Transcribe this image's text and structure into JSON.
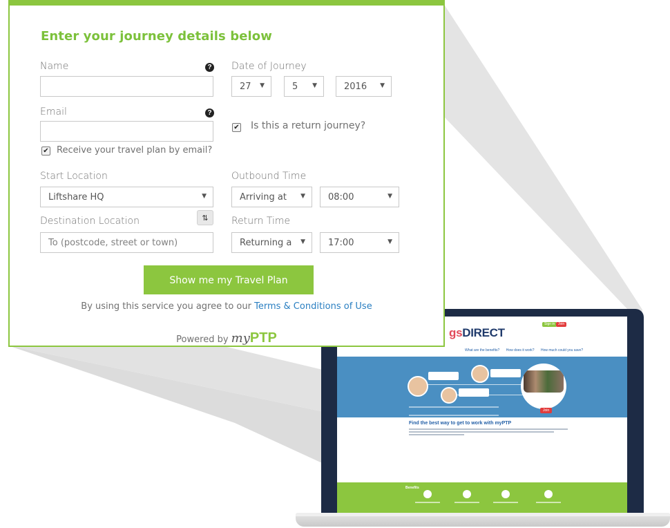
{
  "form": {
    "heading": "Enter your journey details below",
    "name": {
      "label": "Name",
      "value": ""
    },
    "email": {
      "label": "Email",
      "value": ""
    },
    "email_opt_in": {
      "label": "Receive your travel plan by email?",
      "checked": true
    },
    "date": {
      "label": "Date of Journey",
      "day": "27",
      "month": "5",
      "year": "2016"
    },
    "return_journey": {
      "label": "Is this a return journey?",
      "checked": true
    },
    "start_location": {
      "label": "Start Location",
      "value": "Liftshare HQ"
    },
    "destination_location": {
      "label": "Destination Location",
      "placeholder": "To (postcode, street or town)"
    },
    "outbound_time": {
      "label": "Outbound Time",
      "mode": "Arriving at",
      "time": "08:00"
    },
    "return_time": {
      "label": "Return Time",
      "mode": "Returning a",
      "time": "17:00"
    },
    "submit_label": "Show me my Travel Plan",
    "terms_prefix": "By using this service you agree to our",
    "terms_link": "Terms & Conditions of Use",
    "powered_by": "Powered by",
    "brand_my": "my",
    "brand_ptp": "PTP"
  },
  "laptop_site": {
    "logo_partial": "gs",
    "logo_direct": "DIRECT",
    "signin": "Sign in",
    "join": "Join",
    "nav": [
      "What are the benefits?",
      "How does it work?",
      "How much could you save?"
    ],
    "hero_join": "Join",
    "section_title": "Find the best way to get to work with myPTP",
    "benefits_title": "Benefits"
  },
  "colors": {
    "accent_green": "#8cc63f",
    "heading_green": "#7cc13b",
    "link_blue": "#2a7fc1",
    "laptop_frame": "#1d2b45",
    "hero_blue": "#4a8fc2"
  }
}
